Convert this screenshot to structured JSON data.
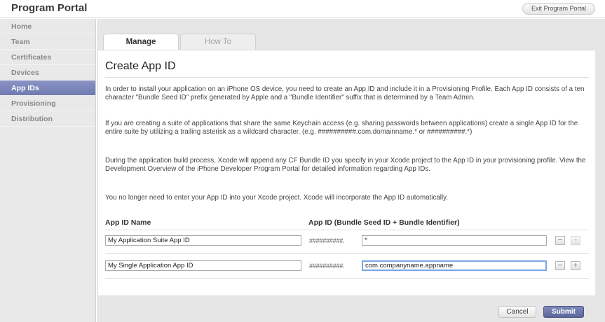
{
  "header": {
    "title": "Program Portal",
    "exit_label": "Exit Program Portal"
  },
  "sidebar": {
    "items": [
      {
        "label": "Home"
      },
      {
        "label": "Team"
      },
      {
        "label": "Certificates"
      },
      {
        "label": "Devices"
      },
      {
        "label": "App IDs",
        "active": true
      },
      {
        "label": "Provisioning"
      },
      {
        "label": "Distribution"
      }
    ]
  },
  "tabs": [
    {
      "label": "Manage",
      "active": true
    },
    {
      "label": "How To"
    }
  ],
  "page": {
    "title": "Create App ID",
    "paragraphs": [
      "In order to install your application on an iPhone OS device, you need to create an App ID and include it in a Provisioning Profile. Each App ID consists of a ten character \"Bundle Seed ID\" prefix generated by Apple and a \"Bundle Identifier\" suffix that is determined by a Team Admin.",
      "If you are creating a suite of applications that share the same Keychain access (e.g. sharing passwords between applications) create a single App ID for the entire suite by utilizing a trailing asterisk as a wildcard character. (e.g. ##########.com.domainname.* or ##########.*)",
      "During the application build process, Xcode will append any CF Bundle ID you specify in your Xcode project to the App ID in your provisioning profile. View the Development Overview of the iPhone Developer Program Portal for detailed information regarding App IDs.",
      "You no longer need to enter your App ID into your Xcode project.  Xcode will incorporate the App ID automatically."
    ]
  },
  "table": {
    "col_name": "App ID Name",
    "col_id": "App ID (Bundle Seed ID + Bundle Identifier)",
    "rows": [
      {
        "name": "My Application Suite App ID",
        "prefix": "##########.",
        "bundle": "*"
      },
      {
        "name": "My Single Application App ID",
        "prefix": "##########.",
        "bundle": "com.companyname.appname"
      }
    ],
    "minus": "−",
    "plus": "+"
  },
  "actions": {
    "cancel": "Cancel",
    "submit": "Submit"
  },
  "colors": {
    "accent": "#6f7ab0",
    "focus": "#7aa7e3"
  }
}
